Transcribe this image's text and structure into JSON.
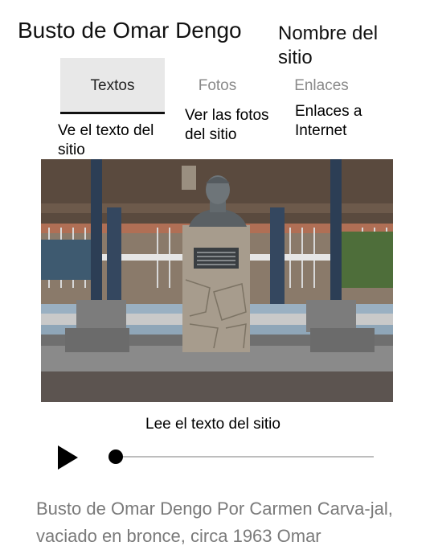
{
  "header": {
    "title": "Busto de Omar Dengo",
    "site_name": "Nombre del sitio"
  },
  "tabs": [
    {
      "label": "Textos",
      "hint": "Ve el texto del sitio",
      "active": true
    },
    {
      "label": "Fotos",
      "hint": "Ver las fotos del sitio",
      "active": false
    },
    {
      "label": "Enlaces",
      "hint": "Enlaces a Internet",
      "active": false
    }
  ],
  "player": {
    "label": "Lee el texto del sitio",
    "progress": 0
  },
  "description": "Busto de Omar Dengo Por Carmen Carva-jal, vaciado en bronce, circa 1963  Omar",
  "colors": {
    "active_tab_bg": "#e8e8e8",
    "inactive_tab_text": "#8a8a8a",
    "body_text_muted": "#7a7a7a"
  }
}
